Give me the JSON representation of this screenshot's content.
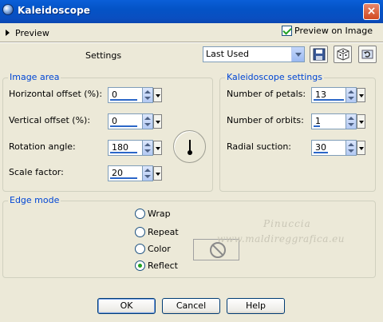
{
  "window": {
    "title": "Kaleidoscope",
    "close_glyph": "×"
  },
  "preview": {
    "label": "Preview",
    "preview_on_image_label": "Preview on Image",
    "preview_on_image_checked": true
  },
  "settings": {
    "label": "Settings",
    "preset_value": "Last Used"
  },
  "image_area": {
    "legend": "Image area",
    "horizontal_offset": {
      "label": "Horizontal offset (%):",
      "value": "0"
    },
    "vertical_offset": {
      "label": "Vertical offset (%):",
      "value": "0"
    },
    "rotation_angle": {
      "label": "Rotation angle:",
      "value": "180"
    },
    "scale_factor": {
      "label": "Scale factor:",
      "value": "20"
    }
  },
  "kaleidoscope_settings": {
    "legend": "Kaleidoscope settings",
    "number_of_petals": {
      "label": "Number of petals:",
      "value": "13"
    },
    "number_of_orbits": {
      "label": "Number of orbits:",
      "value": "1"
    },
    "radial_suction": {
      "label": "Radial suction:",
      "value": "30"
    }
  },
  "edge_mode": {
    "legend": "Edge mode",
    "options": [
      "Wrap",
      "Repeat",
      "Color",
      "Reflect"
    ],
    "selected": "Reflect"
  },
  "watermark": {
    "line1": "Pinuccia",
    "line2": "www.maldireggrafica.eu"
  },
  "buttons": {
    "ok": "OK",
    "cancel": "Cancel",
    "help": "Help"
  },
  "icons": [
    "kaleidoscope-app-icon",
    "close-icon",
    "expand-triangle-icon",
    "save-preset-icon",
    "random-dice-icon",
    "reset-icon",
    "no-color-icon"
  ]
}
